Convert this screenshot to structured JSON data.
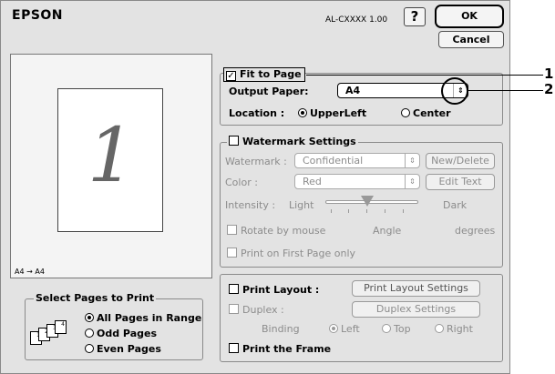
{
  "header": {
    "brand": "EPSON",
    "model": "AL-CXXXX 1.00",
    "help_label": "?",
    "ok_label": "OK",
    "cancel_label": "Cancel"
  },
  "preview": {
    "page_number": "1",
    "paper_conversion": "A4 → A4"
  },
  "fit_to_page": {
    "label": "Fit to Page",
    "checked": true,
    "output_paper_label": "Output Paper:",
    "output_paper_value": "A4",
    "location_label": "Location :",
    "location_options": [
      "UpperLeft",
      "Center"
    ],
    "location_selected": "UpperLeft"
  },
  "watermark": {
    "title": "Watermark Settings",
    "checked": false,
    "watermark_label": "Watermark :",
    "watermark_value": "Confidential",
    "new_delete_label": "New/Delete",
    "color_label": "Color :",
    "color_value": "Red",
    "edit_text_label": "Edit Text",
    "intensity_label": "Intensity :",
    "intensity_light": "Light",
    "intensity_dark": "Dark",
    "rotate_label": "Rotate by mouse",
    "angle_label": "Angle",
    "degrees_label": "degrees",
    "first_page_label": "Print on First Page only"
  },
  "layout": {
    "print_layout_label": "Print Layout :",
    "print_layout_button": "Print Layout Settings",
    "duplex_label": "Duplex :",
    "duplex_button": "Duplex Settings",
    "binding_label": "Binding",
    "binding_options": [
      "Left",
      "Top",
      "Right"
    ],
    "binding_selected": "Left",
    "print_frame_label": "Print the Frame"
  },
  "select_pages": {
    "title": "Select Pages to Print",
    "options": [
      "All Pages in Range",
      "Odd Pages",
      "Even Pages"
    ],
    "selected": "All Pages in Range",
    "icon_pages": [
      "4",
      "3",
      "2",
      "1"
    ]
  },
  "callouts": [
    "1",
    "2"
  ]
}
